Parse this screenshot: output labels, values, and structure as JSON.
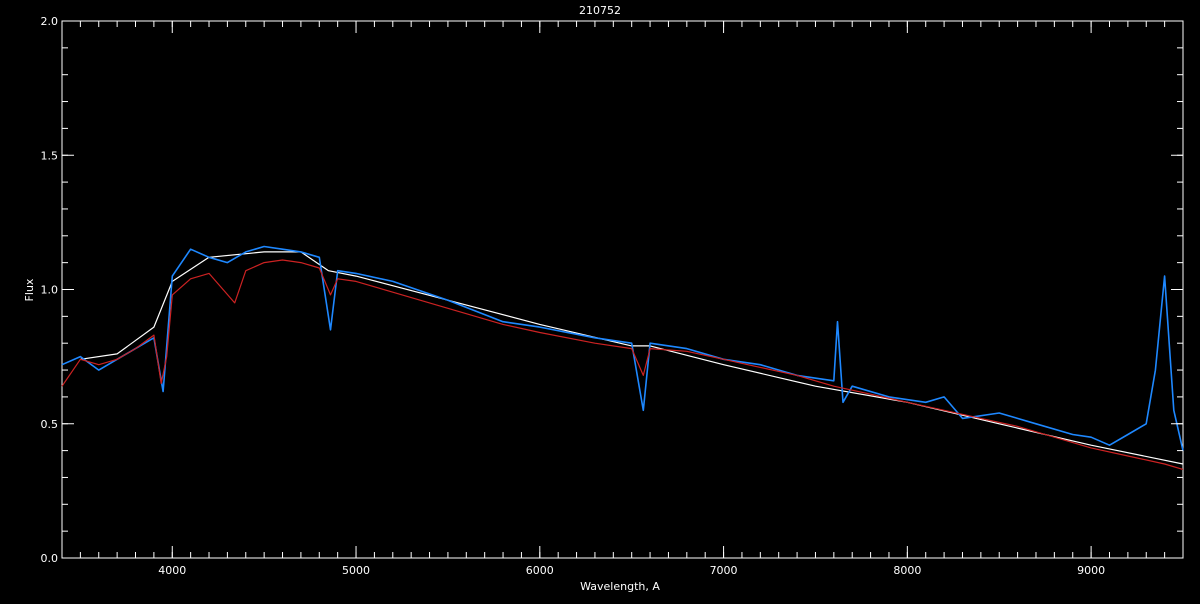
{
  "chart_data": {
    "type": "line",
    "title": "210752",
    "xlabel": "Wavelength, A",
    "ylabel": "Flux",
    "xlim": [
      3400,
      9500
    ],
    "ylim": [
      0.0,
      2.0
    ],
    "x_ticks": [
      4000,
      5000,
      6000,
      7000,
      8000,
      9000
    ],
    "x_tick_labels": [
      "4000",
      "5000",
      "6000",
      "7000",
      "8000",
      "9000"
    ],
    "y_ticks": [
      0.0,
      0.5,
      1.0,
      1.5,
      2.0
    ],
    "y_tick_labels": [
      "0.0",
      "0.5",
      "1.0",
      "1.5",
      "2.0"
    ],
    "grid": false,
    "legend": "none",
    "colors": {
      "background": "#000000",
      "axes": "#ffffff",
      "observed": "#1e88ff",
      "reference": "#ffffff",
      "model": "#cc2222"
    },
    "series": [
      {
        "color": "#ffffff",
        "x": [
          3500,
          3700,
          3900,
          4000,
          4200,
          4500,
          4700,
          4850,
          5000,
          5500,
          6000,
          6500,
          6600,
          7000,
          7500,
          8000,
          8500,
          9000,
          9500
        ],
        "y": [
          0.74,
          0.76,
          0.86,
          1.03,
          1.12,
          1.14,
          1.14,
          1.07,
          1.05,
          0.96,
          0.87,
          0.79,
          0.79,
          0.72,
          0.64,
          0.58,
          0.5,
          0.42,
          0.35
        ]
      },
      {
        "color": "#1e88ff",
        "x": [
          3400,
          3500,
          3600,
          3700,
          3800,
          3900,
          3950,
          4000,
          4100,
          4200,
          4300,
          4400,
          4500,
          4600,
          4700,
          4800,
          4861,
          4900,
          5000,
          5200,
          5500,
          5800,
          6000,
          6300,
          6500,
          6563,
          6600,
          6800,
          7000,
          7200,
          7400,
          7600,
          7620,
          7650,
          7700,
          7900,
          8100,
          8200,
          8300,
          8500,
          8700,
          8900,
          9000,
          9100,
          9200,
          9300,
          9350,
          9400,
          9450,
          9500
        ],
        "y": [
          0.72,
          0.75,
          0.7,
          0.74,
          0.78,
          0.82,
          0.62,
          1.05,
          1.15,
          1.12,
          1.1,
          1.14,
          1.16,
          1.15,
          1.14,
          1.12,
          0.85,
          1.07,
          1.06,
          1.03,
          0.96,
          0.88,
          0.86,
          0.82,
          0.8,
          0.55,
          0.8,
          0.78,
          0.74,
          0.72,
          0.68,
          0.66,
          0.88,
          0.58,
          0.64,
          0.6,
          0.58,
          0.6,
          0.52,
          0.54,
          0.5,
          0.46,
          0.45,
          0.42,
          0.46,
          0.5,
          0.7,
          1.05,
          0.55,
          0.4
        ]
      },
      {
        "color": "#cc2222",
        "x": [
          3400,
          3500,
          3600,
          3700,
          3800,
          3900,
          3940,
          3970,
          4000,
          4100,
          4200,
          4340,
          4400,
          4500,
          4600,
          4700,
          4800,
          4861,
          4900,
          5000,
          5200,
          5500,
          5800,
          6000,
          6300,
          6500,
          6563,
          6600,
          6800,
          7000,
          7200,
          7400,
          7600,
          7800,
          8000,
          8200,
          8400,
          8600,
          8800,
          9000,
          9200,
          9400,
          9500
        ],
        "y": [
          0.64,
          0.74,
          0.72,
          0.74,
          0.78,
          0.83,
          0.65,
          0.75,
          0.98,
          1.04,
          1.06,
          0.95,
          1.07,
          1.1,
          1.11,
          1.1,
          1.08,
          0.98,
          1.04,
          1.03,
          0.99,
          0.93,
          0.87,
          0.84,
          0.8,
          0.78,
          0.68,
          0.78,
          0.77,
          0.74,
          0.71,
          0.68,
          0.64,
          0.61,
          0.58,
          0.55,
          0.52,
          0.49,
          0.45,
          0.41,
          0.38,
          0.35,
          0.33
        ]
      }
    ]
  }
}
